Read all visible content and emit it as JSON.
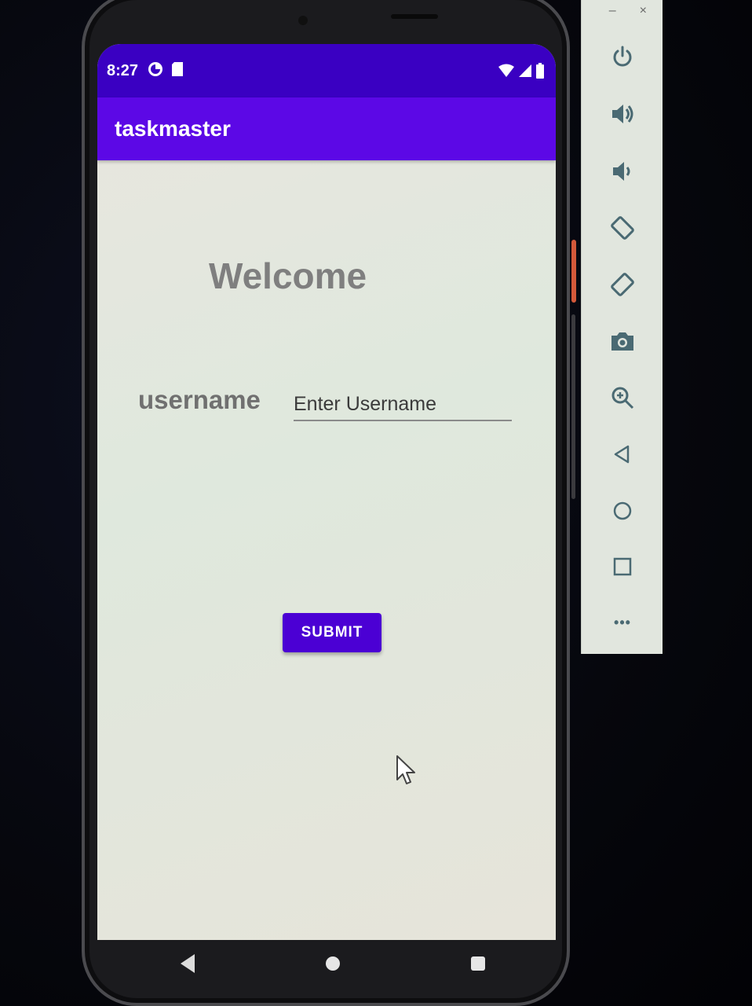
{
  "status_bar": {
    "time": "8:27"
  },
  "app_bar": {
    "title": "taskmaster"
  },
  "main": {
    "welcome_text": "Welcome",
    "username_label": "username",
    "username_placeholder": "Enter Username",
    "username_value": "",
    "submit_label": "SUBMIT"
  },
  "emulator_toolbar": {
    "minimize_label": "–",
    "close_label": "×",
    "more_label": "•••",
    "buttons": [
      "power-icon",
      "volume-up-icon",
      "volume-down-icon",
      "rotate-left-icon",
      "rotate-right-icon",
      "camera-icon",
      "zoom-icon",
      "back-icon",
      "home-icon",
      "overview-icon",
      "more-icon"
    ]
  },
  "colors": {
    "status_bar": "#3a00c2",
    "app_bar": "#5c08e6",
    "button": "#4b00d4",
    "screen_bg": "#e6e6dd"
  }
}
